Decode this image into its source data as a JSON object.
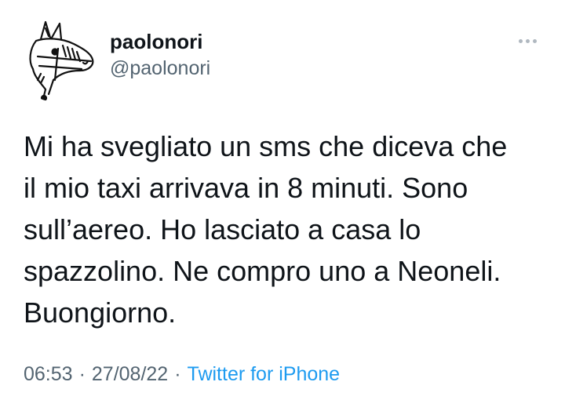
{
  "author": {
    "display_name": "paolonori",
    "handle": "@paolonori",
    "avatar_icon": "donkey-head-sketch-icon"
  },
  "more_icon": "more-dots-icon",
  "tweet": {
    "lines": [
      "Mi ha svegliato un sms che diceva che",
      "il mio taxi arrivava in 8 minuti. Sono",
      "sull’aereo. Ho lasciato a casa lo",
      "spazzolino. Ne compro uno a Neoneli.",
      "Buongiorno."
    ]
  },
  "meta": {
    "time": "06:53",
    "date": "27/08/22",
    "separator": "·",
    "source": "Twitter for iPhone"
  },
  "colors": {
    "text": "#0f1419",
    "secondary": "#536471",
    "link": "#1d9bf0"
  }
}
